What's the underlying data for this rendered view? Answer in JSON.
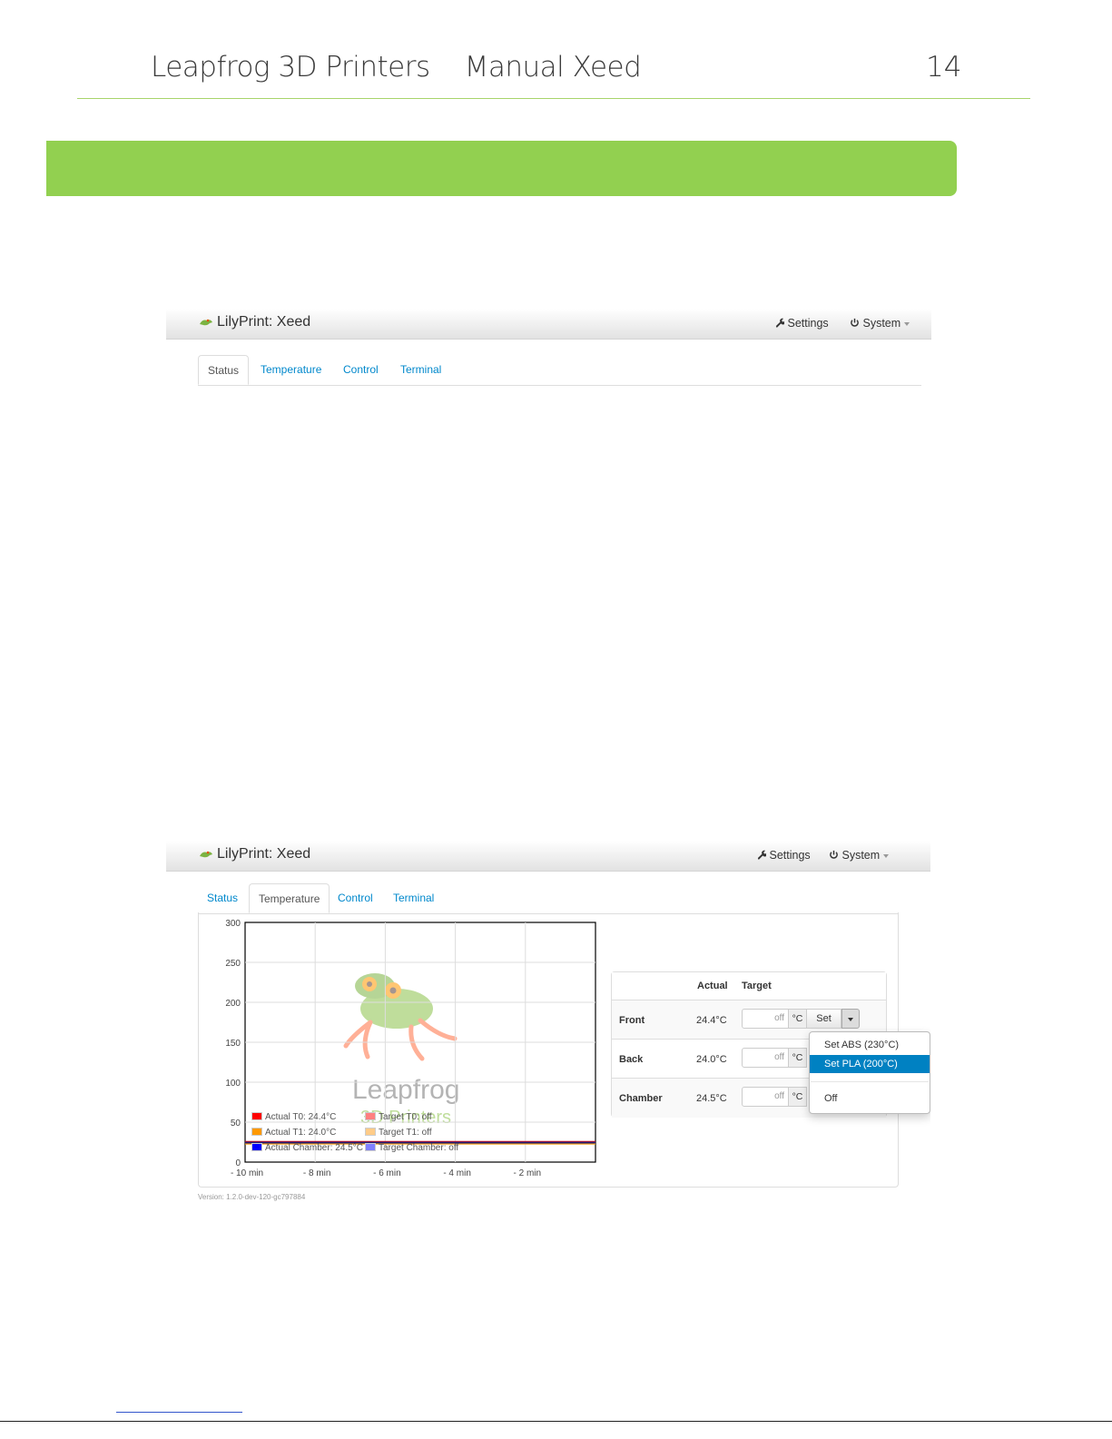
{
  "doc": {
    "header_left": "Leapfrog 3D Printers",
    "header_title": "Manual Xeed",
    "page_number": "14"
  },
  "app": {
    "brand": "LilyPrint: Xeed",
    "settings_label": "Settings",
    "system_label": "System"
  },
  "tabs": [
    "Status",
    "Temperature",
    "Control",
    "Terminal"
  ],
  "temperature": {
    "headers": {
      "actual": "Actual",
      "target": "Target"
    },
    "rows": [
      {
        "name": "Front",
        "actual": "24.4°C",
        "target_placeholder": "off",
        "unit": "°C",
        "set_label": "Set"
      },
      {
        "name": "Back",
        "actual": "24.0°C",
        "target_placeholder": "off",
        "unit": "°C"
      },
      {
        "name": "Chamber",
        "actual": "24.5°C",
        "target_placeholder": "off",
        "unit": "°C"
      }
    ],
    "dropdown": [
      "Set ABS (230°C)",
      "Set PLA (200°C)",
      "Off"
    ]
  },
  "version": "Version: 1.2.0-dev-120-gc797884",
  "watermark": {
    "top": "Leapfrog",
    "bottom": "3D Printers"
  },
  "colors": {
    "accent_green": "#92d050",
    "link_blue": "#0088cc",
    "dropdown_active": "#0081c2"
  },
  "chart_data": {
    "type": "line",
    "x_ticks": [
      "- 10 min",
      "- 8 min",
      "- 6 min",
      "- 4 min",
      "- 2 min"
    ],
    "y_ticks": [
      0,
      50,
      100,
      150,
      200,
      250,
      300
    ],
    "ylim": [
      0,
      300
    ],
    "xlim": [
      -10,
      0
    ],
    "grid": true,
    "series": [
      {
        "name": "Actual T0: 24.4°C",
        "color": "#ff0000",
        "y": 24.4
      },
      {
        "name": "Target T0: off",
        "color": "#ff8080",
        "y": null
      },
      {
        "name": "Actual T1: 24.0°C",
        "color": "#ff9900",
        "y": 24.0
      },
      {
        "name": "Target T1: off",
        "color": "#ffcc88",
        "y": null
      },
      {
        "name": "Actual Chamber: 24.5°C",
        "color": "#0000ff",
        "y": 24.5
      },
      {
        "name": "Target Chamber: off",
        "color": "#8080ff",
        "y": null
      }
    ]
  }
}
